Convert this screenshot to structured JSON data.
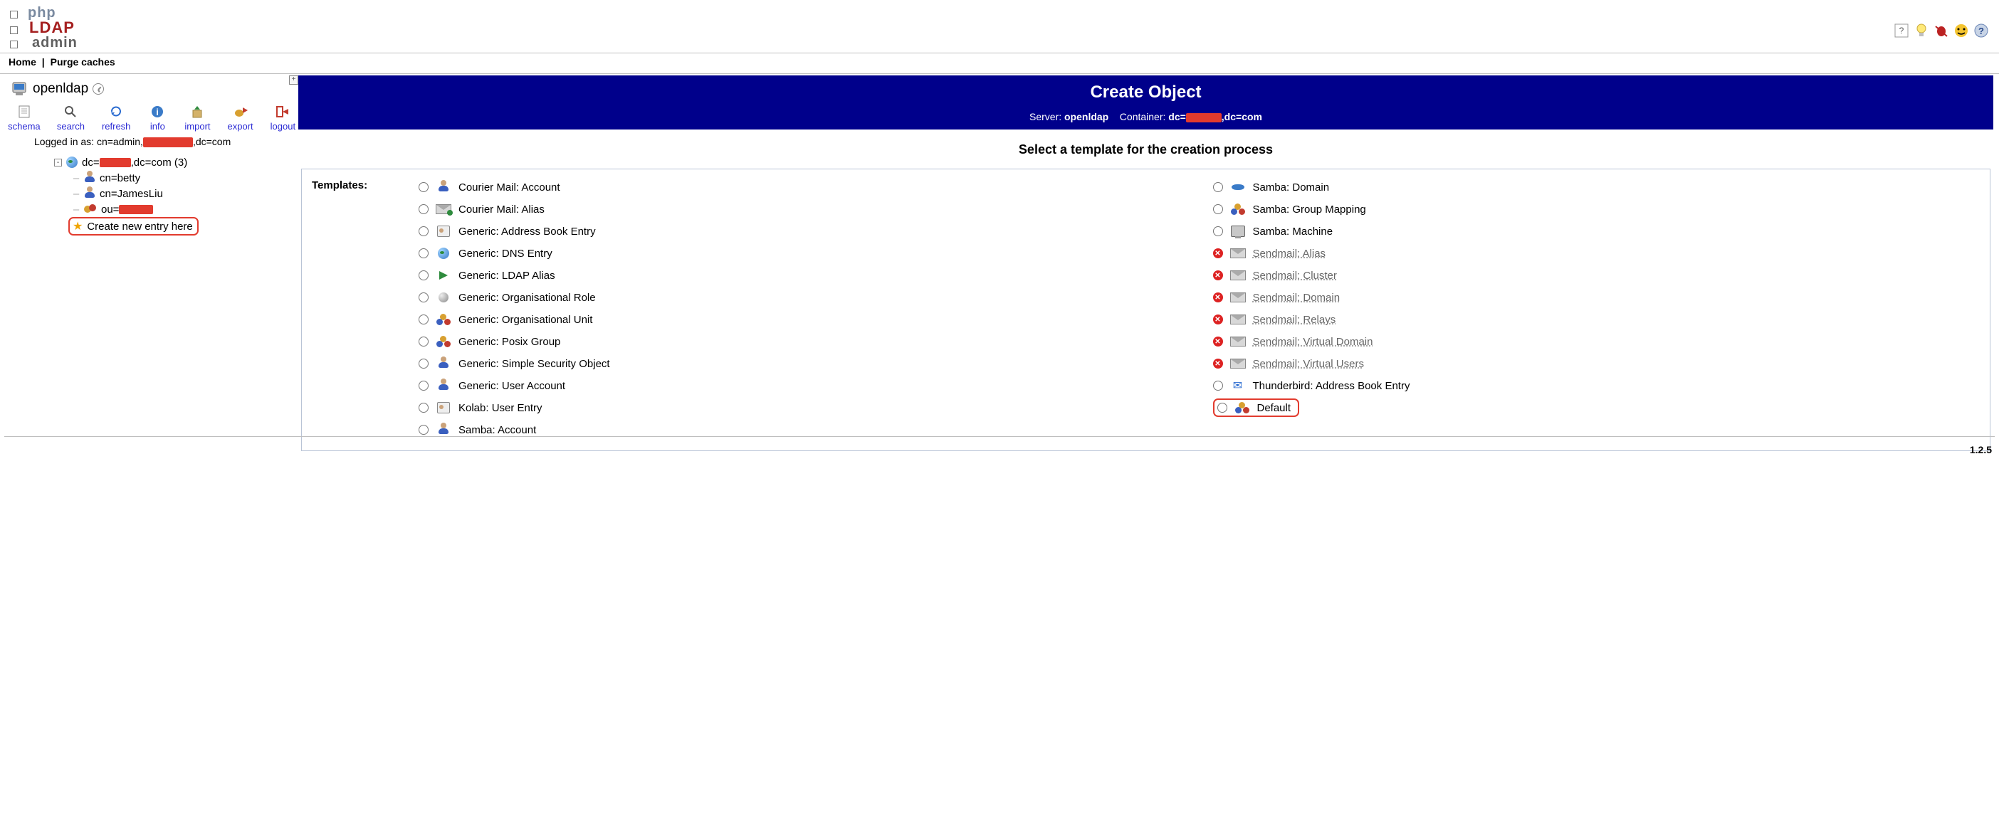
{
  "app": {
    "logo_php": "php",
    "logo_ldap": "LDAP",
    "logo_admin": "admin"
  },
  "top_icons": [
    "help",
    "lightbulb",
    "bug",
    "smiley",
    "question"
  ],
  "nav": {
    "home": "Home",
    "purge": "Purge caches"
  },
  "sidebar": {
    "server_name": "openldap",
    "tools": {
      "schema": "schema",
      "search": "search",
      "refresh": "refresh",
      "info": "info",
      "import": "import",
      "export": "export",
      "logout": "logout"
    },
    "logged_prefix": "Logged in as: cn=admin,",
    "logged_suffix": ",dc=com",
    "tree": {
      "root_prefix": "dc=",
      "root_mid": ",dc=com",
      "root_count": "(3)",
      "children": [
        {
          "icon": "person",
          "label": "cn=betty"
        },
        {
          "icon": "person",
          "label": "cn=JamesLiu"
        },
        {
          "icon": "people",
          "label_prefix": "ou="
        }
      ],
      "create_label": "Create new entry here"
    }
  },
  "main": {
    "title": "Create Object",
    "sub_server_label": "Server:",
    "sub_server": "openldap",
    "sub_container_label": "Container:",
    "sub_container_prefix": "dc=",
    "sub_container_suffix": ",dc=com",
    "prompt": "Select a template for the creation process",
    "templates_label": "Templates:",
    "templates_left": [
      {
        "icon": "person",
        "label": "Courier Mail: Account",
        "enabled": true
      },
      {
        "icon": "envgreen",
        "label": "Courier Mail: Alias",
        "enabled": true
      },
      {
        "icon": "book",
        "label": "Generic: Address Book Entry",
        "enabled": true
      },
      {
        "icon": "globe",
        "label": "Generic: DNS Entry",
        "enabled": true
      },
      {
        "icon": "arrow",
        "label": "Generic: LDAP Alias",
        "enabled": true
      },
      {
        "icon": "gball",
        "label": "Generic: Organisational Role",
        "enabled": true
      },
      {
        "icon": "tri",
        "label": "Generic: Organisational Unit",
        "enabled": true
      },
      {
        "icon": "tri",
        "label": "Generic: Posix Group",
        "enabled": true
      },
      {
        "icon": "person",
        "label": "Generic: Simple Security Object",
        "enabled": true
      },
      {
        "icon": "person",
        "label": "Generic: User Account",
        "enabled": true
      },
      {
        "icon": "book",
        "label": "Kolab: User Entry",
        "enabled": true
      },
      {
        "icon": "person",
        "label": "Samba: Account",
        "enabled": true
      }
    ],
    "templates_right": [
      {
        "icon": "disk",
        "label": "Samba: Domain",
        "enabled": true
      },
      {
        "icon": "tri",
        "label": "Samba: Group Mapping",
        "enabled": true
      },
      {
        "icon": "monitor",
        "label": "Samba: Machine",
        "enabled": true
      },
      {
        "icon": "env",
        "label": "Sendmail: Alias",
        "enabled": false
      },
      {
        "icon": "env",
        "label": "Sendmail: Cluster",
        "enabled": false
      },
      {
        "icon": "env",
        "label": "Sendmail: Domain",
        "enabled": false
      },
      {
        "icon": "env",
        "label": "Sendmail: Relays",
        "enabled": false
      },
      {
        "icon": "env",
        "label": "Sendmail: Virtual Domain",
        "enabled": false
      },
      {
        "icon": "env",
        "label": "Sendmail: Virtual Users",
        "enabled": false
      },
      {
        "icon": "bird",
        "label": "Thunderbird: Address Book Entry",
        "enabled": true
      },
      {
        "icon": "tri",
        "label": "Default",
        "enabled": true,
        "highlight": true
      }
    ]
  },
  "version": "1.2.5"
}
